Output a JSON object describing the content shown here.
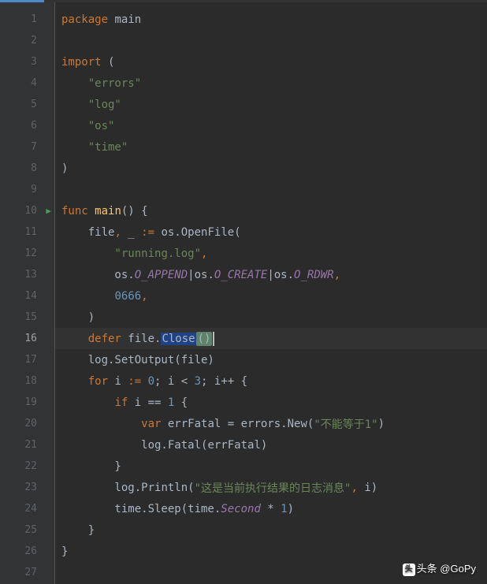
{
  "cursor_line": 16,
  "run_line": 10,
  "lines": [
    {
      "n": 1,
      "t": [
        [
          "kw",
          "package "
        ],
        [
          "ident",
          "main"
        ]
      ]
    },
    {
      "n": 2,
      "t": []
    },
    {
      "n": 3,
      "t": [
        [
          "kw",
          "import "
        ],
        [
          "ident",
          "("
        ]
      ],
      "fold": "-"
    },
    {
      "n": 4,
      "t": [
        [
          "ident",
          "    "
        ],
        [
          "str",
          "\"errors\""
        ]
      ]
    },
    {
      "n": 5,
      "t": [
        [
          "ident",
          "    "
        ],
        [
          "str",
          "\"log\""
        ]
      ]
    },
    {
      "n": 6,
      "t": [
        [
          "ident",
          "    "
        ],
        [
          "str",
          "\"os\""
        ]
      ]
    },
    {
      "n": 7,
      "t": [
        [
          "ident",
          "    "
        ],
        [
          "str",
          "\"time\""
        ]
      ]
    },
    {
      "n": 8,
      "t": [
        [
          "ident",
          ")"
        ]
      ],
      "fold": "^"
    },
    {
      "n": 9,
      "t": []
    },
    {
      "n": 10,
      "t": [
        [
          "kw",
          "func "
        ],
        [
          "fn",
          "main"
        ],
        [
          "ident",
          "() {"
        ]
      ],
      "fold": "-"
    },
    {
      "n": 11,
      "t": [
        [
          "ident",
          "    file"
        ],
        [
          "kw",
          ", "
        ],
        [
          "ident",
          "_ "
        ],
        [
          "kw",
          ":= "
        ],
        [
          "ident",
          "os."
        ],
        [
          "ident",
          "OpenFile("
        ]
      ]
    },
    {
      "n": 12,
      "t": [
        [
          "ident",
          "        "
        ],
        [
          "str",
          "\"running.log\""
        ],
        [
          "kw",
          ","
        ]
      ]
    },
    {
      "n": 13,
      "t": [
        [
          "ident",
          "        os."
        ],
        [
          "const",
          "O_APPEND"
        ],
        [
          "ident",
          "|os."
        ],
        [
          "const",
          "O_CREATE"
        ],
        [
          "ident",
          "|os."
        ],
        [
          "const",
          "O_RDWR"
        ],
        [
          "kw",
          ","
        ]
      ]
    },
    {
      "n": 14,
      "t": [
        [
          "ident",
          "        "
        ],
        [
          "num",
          "0666"
        ],
        [
          "kw",
          ","
        ]
      ]
    },
    {
      "n": 15,
      "t": [
        [
          "ident",
          "    )"
        ]
      ]
    },
    {
      "n": 16,
      "t": [
        [
          "ident",
          "    "
        ],
        [
          "kw",
          "defer "
        ],
        [
          "ident",
          "file."
        ],
        [
          "sel",
          "Close"
        ],
        [
          "closebox",
          "()"
        ]
      ],
      "hl": true,
      "cursor": true
    },
    {
      "n": 17,
      "t": [
        [
          "ident",
          "    log.SetOutput(file)"
        ]
      ]
    },
    {
      "n": 18,
      "t": [
        [
          "ident",
          "    "
        ],
        [
          "kw",
          "for "
        ],
        [
          "ident",
          "i "
        ],
        [
          "kw",
          ":= "
        ],
        [
          "num",
          "0"
        ],
        [
          "ident",
          "; i < "
        ],
        [
          "num",
          "3"
        ],
        [
          "ident",
          "; i++ {"
        ]
      ],
      "fold": "-"
    },
    {
      "n": 19,
      "t": [
        [
          "ident",
          "        "
        ],
        [
          "kw",
          "if "
        ],
        [
          "ident",
          "i == "
        ],
        [
          "num",
          "1"
        ],
        [
          "ident",
          " {"
        ]
      ],
      "fold": "-"
    },
    {
      "n": 20,
      "t": [
        [
          "ident",
          "            "
        ],
        [
          "kw",
          "var "
        ],
        [
          "ident",
          "errFatal = errors.New("
        ],
        [
          "str",
          "\"不能等于1\""
        ],
        [
          "ident",
          ")"
        ]
      ]
    },
    {
      "n": 21,
      "t": [
        [
          "ident",
          "            log."
        ],
        [
          "ident",
          "Fatal"
        ],
        [
          "ident",
          "(errFatal)"
        ]
      ]
    },
    {
      "n": 22,
      "t": [
        [
          "ident",
          "        }"
        ]
      ],
      "fold": "^"
    },
    {
      "n": 23,
      "t": [
        [
          "ident",
          "        log."
        ],
        [
          "ident",
          "Println"
        ],
        [
          "ident",
          "("
        ],
        [
          "str",
          "\"这是当前执行结果的日志消息\""
        ],
        [
          "kw",
          ", "
        ],
        [
          "ident",
          "i)"
        ]
      ]
    },
    {
      "n": 24,
      "t": [
        [
          "ident",
          "        time.Sleep(time."
        ],
        [
          "const",
          "Second"
        ],
        [
          "ident",
          " * "
        ],
        [
          "num",
          "1"
        ],
        [
          "ident",
          ")"
        ]
      ]
    },
    {
      "n": 25,
      "t": [
        [
          "ident",
          "    }"
        ]
      ],
      "fold": "^"
    },
    {
      "n": 26,
      "t": [
        [
          "ident",
          "}"
        ]
      ],
      "fold": "^"
    },
    {
      "n": 27,
      "t": []
    }
  ],
  "watermark": {
    "brand": "头条",
    "handle": "@GoPy"
  }
}
